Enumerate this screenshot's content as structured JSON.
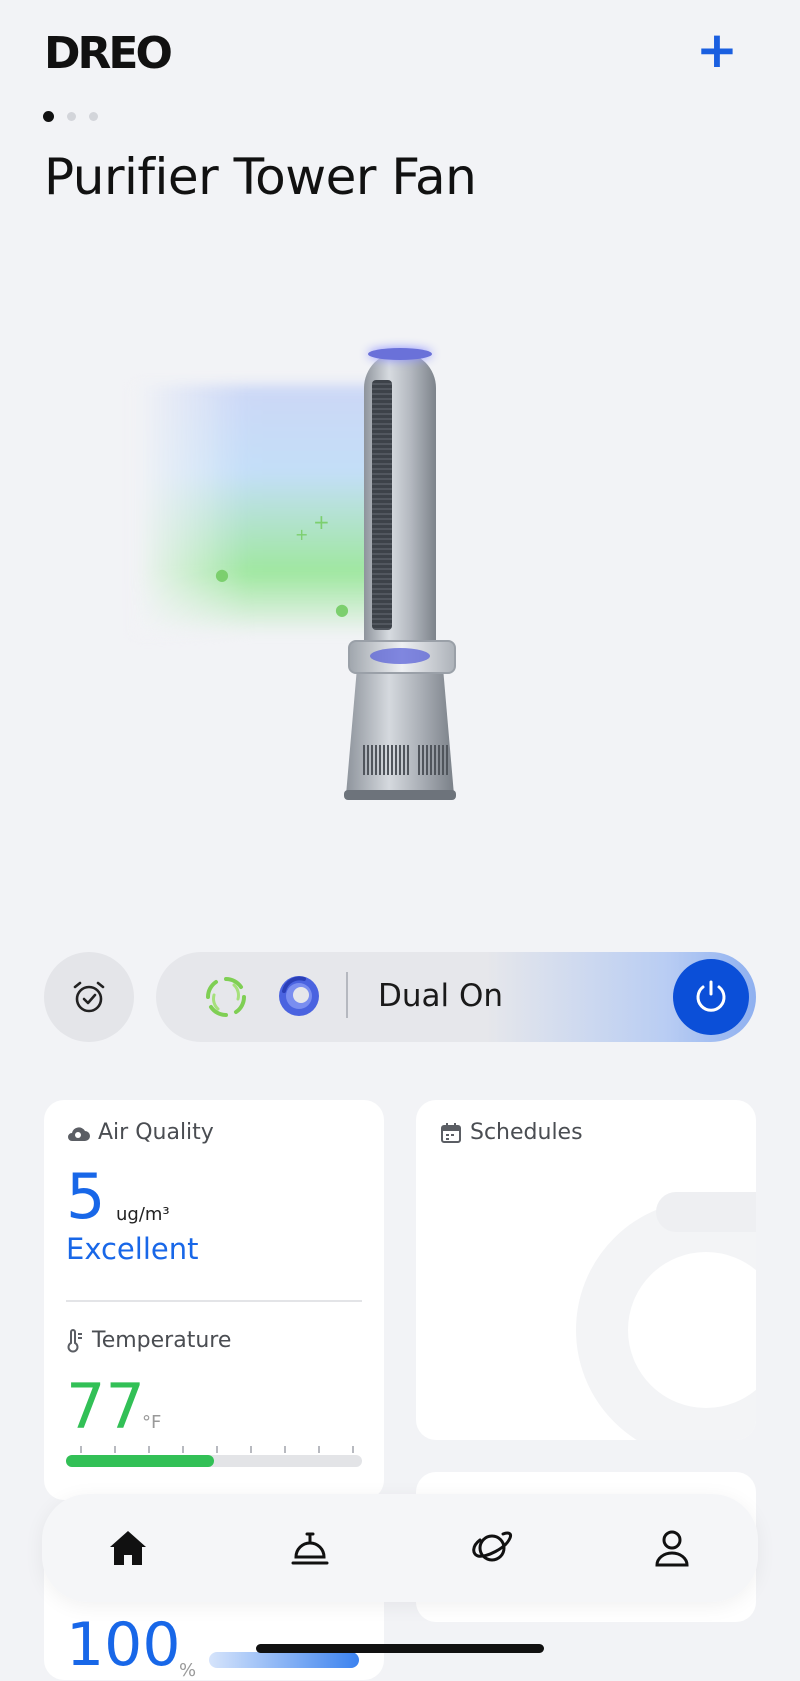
{
  "header": {
    "logo_text": "DREO",
    "add_icon": "plus-icon",
    "pager": {
      "total": 3,
      "active_index": 0
    }
  },
  "device": {
    "name": "Purifier Tower Fan",
    "image": "purifier-tower-fan-illustration"
  },
  "controls": {
    "timer_icon": "alarm-clock-icon",
    "mode_icons": [
      "purify-mode-icon",
      "fan-mode-icon"
    ],
    "mode_label": "Dual On",
    "power_icon": "power-icon"
  },
  "air_quality": {
    "title": "Air Quality",
    "icon": "cloud-icon",
    "value": "5",
    "unit": "ug/m³",
    "rating": "Excellent"
  },
  "temperature": {
    "title": "Temperature",
    "icon": "thermometer-icon",
    "value": "77",
    "unit": "°F",
    "level_fraction": 0.5
  },
  "schedules": {
    "title": "Schedules",
    "icon": "calendar-icon"
  },
  "humidity": {
    "value": "100",
    "unit": "%"
  },
  "tabbar": {
    "items": [
      "home-icon",
      "service-bell-icon",
      "planet-icon",
      "profile-icon"
    ],
    "active": "home-icon"
  },
  "colors": {
    "accent_blue": "#0b4fd8",
    "value_blue": "#1867e8",
    "temp_green": "#32c056",
    "background": "#f2f3f6"
  }
}
